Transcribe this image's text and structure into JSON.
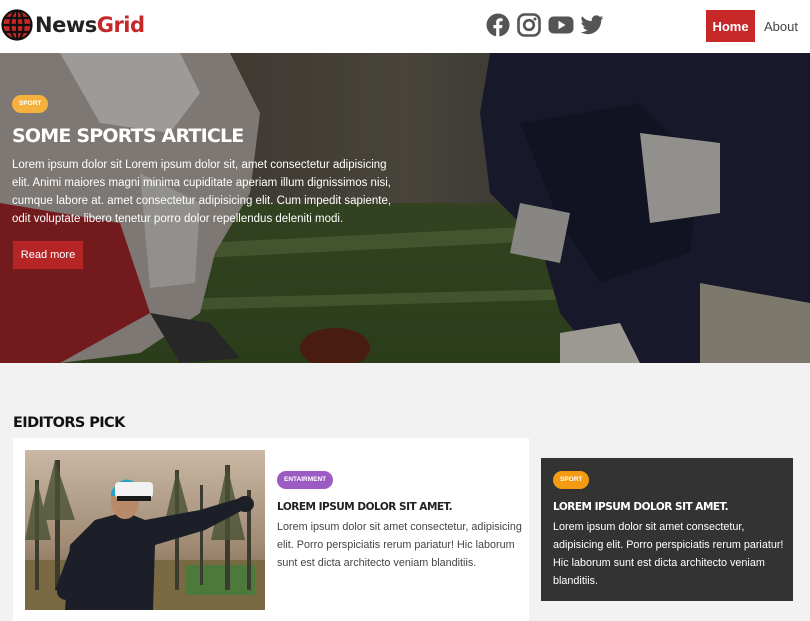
{
  "brand": {
    "name_part1": "News",
    "name_part2": "Grid",
    "accent": "#c62828"
  },
  "socials": [
    {
      "icon": "facebook-icon"
    },
    {
      "icon": "instagram-icon"
    },
    {
      "icon": "youtube-icon"
    },
    {
      "icon": "twitter-icon"
    }
  ],
  "nav": {
    "home": "Home",
    "about": "About"
  },
  "hero": {
    "tag": "Sport",
    "title": "Some Sports Article",
    "text": "Lorem ipsum dolor sit Lorem ipsum dolor sit, amet consectetur adipisicing elit. Animi maiores magni minima cupiditate aperiam illum dignissimos nisi, cumque labore at. amet consectetur adipisicing elit. Cum impedit sapiente, odit voluptate libero tenetur porro dolor repellendus deleniti modi.",
    "button": "Read more"
  },
  "editors_pick": {
    "title": "Eiditors Pick",
    "main_card": {
      "tag": "Entairment",
      "title": "Lorem ipsum dolor sit amet.",
      "text": "Lorem ipsum dolor sit amet consectetur, adipisicing elit. Porro perspiciatis rerum pariatur! Hic laborum sunt est dicta architecto veniam blanditiis."
    },
    "side_card": {
      "tag": "Sport",
      "title": "Lorem ipsum dolor sit amet.",
      "text": "Lorem ipsum dolor sit amet consectetur, adipisicing elit. Porro perspiciatis rerum pariatur! Hic laborum sunt est dicta architecto veniam blanditiis."
    }
  },
  "colors": {
    "sport_tag": "#f4b13e",
    "entertainment_tag": "#9c5bc2",
    "side_card_bg": "#333333",
    "page_bg": "#f2f2f2"
  }
}
